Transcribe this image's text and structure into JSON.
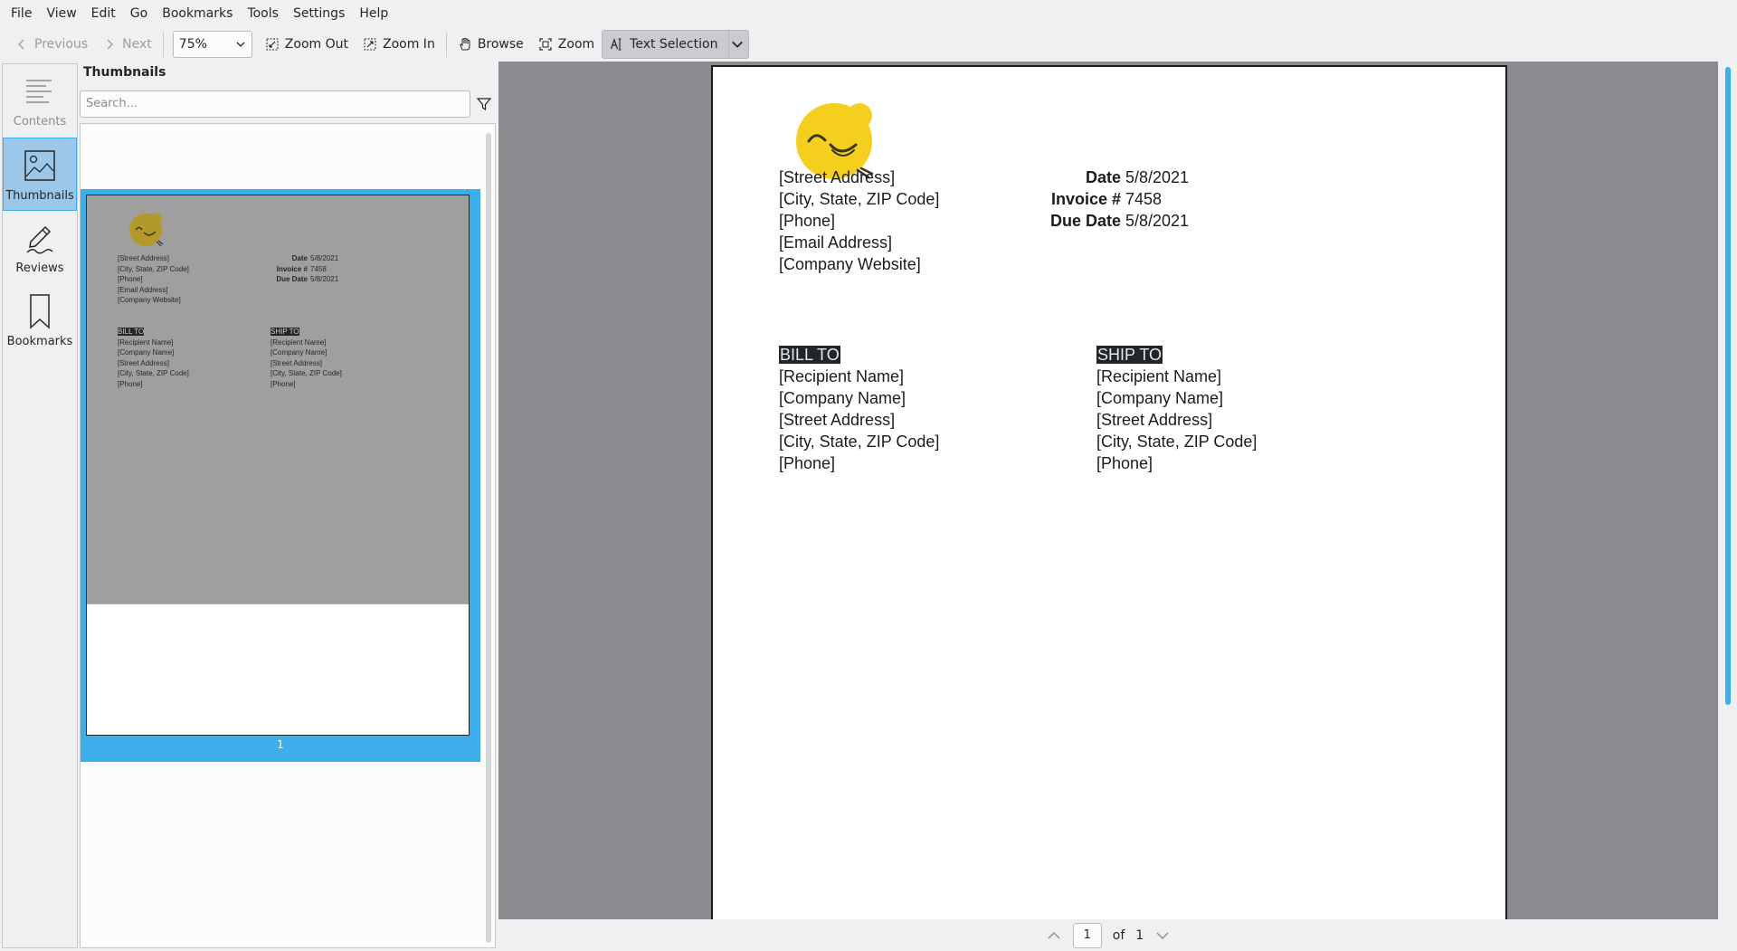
{
  "menubar": {
    "items": [
      "File",
      "View",
      "Edit",
      "Go",
      "Bookmarks",
      "Tools",
      "Settings",
      "Help"
    ]
  },
  "toolbar": {
    "previous_label": "Previous",
    "next_label": "Next",
    "zoom_value": "75%",
    "zoom_out_label": "Zoom Out",
    "zoom_in_label": "Zoom In",
    "browse_label": "Browse",
    "zoom_label": "Zoom",
    "text_selection_label": "Text Selection"
  },
  "sidebar": {
    "tabs": [
      {
        "label": "Contents",
        "icon": "contents-icon",
        "state": "disabled"
      },
      {
        "label": "Thumbnails",
        "icon": "thumbnails-icon",
        "state": "selected"
      },
      {
        "label": "Reviews",
        "icon": "reviews-icon",
        "state": "normal"
      },
      {
        "label": "Bookmarks",
        "icon": "bookmark-icon",
        "state": "normal"
      }
    ]
  },
  "thumbnails": {
    "title": "Thumbnails",
    "search_placeholder": "Search...",
    "page_number": "1"
  },
  "document": {
    "from_lines": [
      "[Street Address]",
      "[City, State, ZIP Code]",
      "[Phone]",
      "[Email Address]",
      "[Company Website]"
    ],
    "meta": [
      {
        "label": "Date",
        "value": "5/8/2021"
      },
      {
        "label": "Invoice #",
        "value": "7458"
      },
      {
        "label": "Due Date",
        "value": "5/8/2021"
      }
    ],
    "bill_to": {
      "heading": "BILL TO",
      "lines": [
        "[Recipient Name]",
        "[Company Name]",
        "[Street Address]",
        "[City, State, ZIP Code]",
        "[Phone]"
      ]
    },
    "ship_to": {
      "heading": "SHIP TO",
      "lines": [
        "[Recipient Name]",
        "[Company Name]",
        "[Street Address]",
        "[City, State, ZIP Code]",
        "[Phone]"
      ]
    },
    "logo_color": "#f5cf1d",
    "selection_color": "#232629"
  },
  "page_nav": {
    "current": "1",
    "of_label": "of",
    "total": "1"
  },
  "colors": {
    "accent": "#3daee9",
    "canvas": "#898b8f",
    "window": "#eff0f1"
  }
}
